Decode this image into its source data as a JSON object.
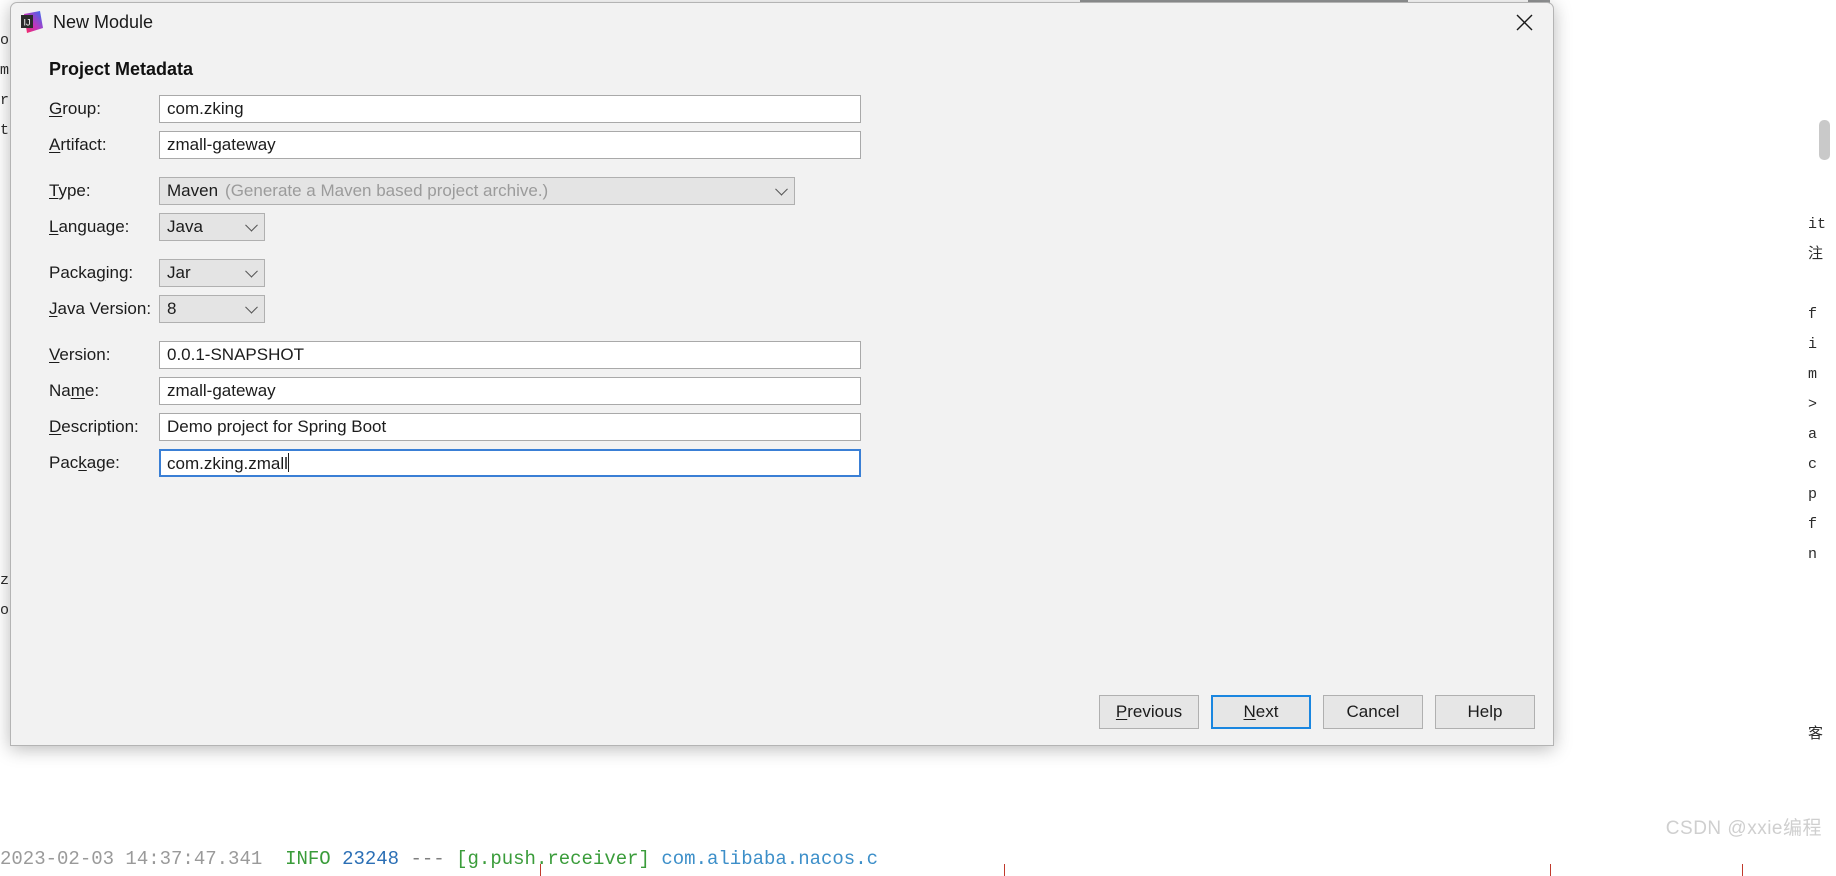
{
  "dialog": {
    "title": "New Module",
    "app_icon": "intellij-idea-icon",
    "close_icon": "close-icon",
    "section_title": "Project Metadata"
  },
  "fields": [
    {
      "label": "Group:",
      "mnemonic_index": 0,
      "kind": "text",
      "value": "com.zking",
      "name": "group"
    },
    {
      "label": "Artifact:",
      "mnemonic_index": 0,
      "kind": "text",
      "value": "zmall-gateway",
      "name": "artifact"
    },
    {
      "label": "Type:",
      "mnemonic_index": 0,
      "kind": "combo-wide",
      "value": "Maven",
      "hint": "(Generate a Maven based project archive.)",
      "name": "type"
    },
    {
      "label": "Language:",
      "mnemonic_index": 0,
      "kind": "combo",
      "value": "Java",
      "name": "language"
    },
    {
      "label": "Packaging:",
      "mnemonic_index": 5,
      "kind": "combo",
      "value": "Jar",
      "name": "packaging"
    },
    {
      "label": "Java Version:",
      "mnemonic_index": 0,
      "kind": "combo",
      "value": "8",
      "name": "java-version"
    },
    {
      "label": "Version:",
      "mnemonic_index": 0,
      "kind": "text",
      "value": "0.0.1-SNAPSHOT",
      "name": "version"
    },
    {
      "label": "Name:",
      "mnemonic_index": 2,
      "kind": "text",
      "value": "zmall-gateway",
      "name": "name"
    },
    {
      "label": "Description:",
      "mnemonic_index": 0,
      "kind": "text",
      "value": "Demo project for Spring Boot",
      "name": "description"
    },
    {
      "label": "Package:",
      "mnemonic_index": 3,
      "kind": "text",
      "value": "com.zking.zmall",
      "name": "package",
      "focused": true
    }
  ],
  "buttons": [
    {
      "label": "Previous",
      "mnemonic_index": 0,
      "name": "previous-button",
      "primary": false
    },
    {
      "label": "Next",
      "mnemonic_index": 0,
      "name": "next-button",
      "primary": true
    },
    {
      "label": "Cancel",
      "mnemonic_index": -1,
      "name": "cancel-button",
      "primary": false
    },
    {
      "label": "Help",
      "mnemonic_index": -1,
      "name": "help-button",
      "primary": false
    }
  ],
  "background": {
    "left_gutter_chars": [
      "o",
      "m",
      "rn",
      "tc",
      "",
      "",
      "",
      "",
      "",
      "",
      "",
      "",
      "",
      "",
      "",
      "",
      "",
      "",
      "z",
      "o"
    ],
    "right_gutter_chars": [
      "",
      "",
      "it",
      "注",
      "",
      "f",
      "i",
      "m",
      ">",
      "a",
      "c",
      "p",
      "f",
      "n",
      "",
      "",
      "",
      "",
      "",
      "客"
    ],
    "console": {
      "timestamp": "2023-02-03 14:37:47.341",
      "level": "INFO",
      "pid": "23248",
      "dashes": "---",
      "thread": "[g.push.receiver]",
      "logger": "com.alibaba.nacos.c"
    },
    "watermark": "CSDN @xxie编程"
  },
  "colors": {
    "dialog_bg": "#f2f2f2",
    "focus_blue": "#3a7fd5",
    "primary_border": "#1a86e0",
    "field_bg": "#ffffff",
    "combo_bg": "#e4e4e4",
    "text": "#1c1c1c",
    "hint": "#9b9b9b"
  }
}
